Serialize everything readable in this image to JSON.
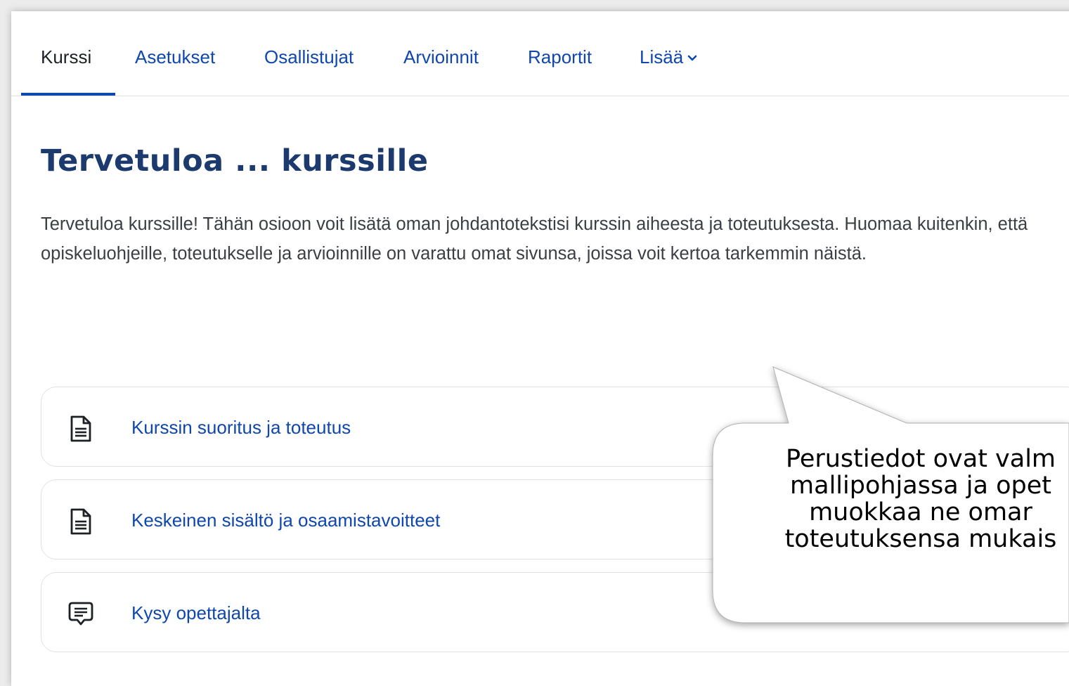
{
  "nav": {
    "tabs": [
      {
        "label": "Kurssi"
      },
      {
        "label": "Asetukset"
      },
      {
        "label": "Osallistujat"
      },
      {
        "label": "Arvioinnit"
      },
      {
        "label": "Raportit"
      },
      {
        "label": "Lisää"
      }
    ],
    "active_tab": "Kurssi"
  },
  "page": {
    "title": "Tervetuloa ... kurssille",
    "intro": "Tervetuloa kurssille! Tähän osioon voit lisätä oman johdantotekstisi kurssin aiheesta ja toteutuksesta. Huomaa kuitenkin, että opiskeluohjeille, toteutukselle ja arvioinnille on varattu omat sivunsa, joissa voit kertoa tarkemmin näistä."
  },
  "activities": [
    {
      "label": "Kurssin suoritus ja toteutus",
      "icon": "page-icon"
    },
    {
      "label": "Keskeinen sisältö ja osaamistavoitteet",
      "icon": "page-icon"
    },
    {
      "label": "Kysy opettajalta",
      "icon": "forum-icon"
    }
  ],
  "callout": {
    "lines": [
      "Perustiedot ovat valm",
      "mallipohjassa ja opet",
      "muokkaa ne omar",
      "toteutuksensa mukais"
    ]
  },
  "colors": {
    "link": "#0f47ad",
    "title": "#1c3a6e",
    "border": "#dee2e6"
  }
}
